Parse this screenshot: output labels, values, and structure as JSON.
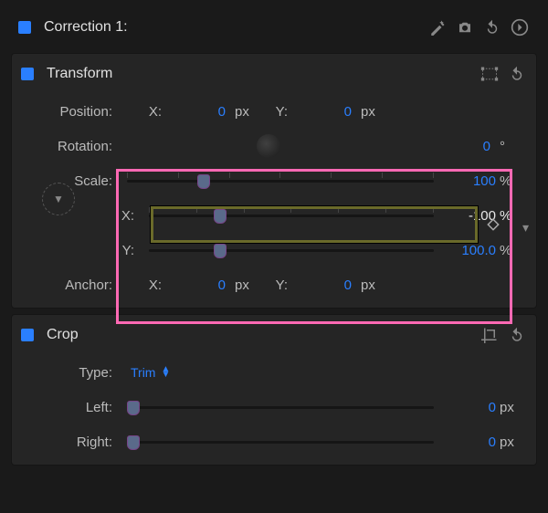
{
  "correction": {
    "title": "Correction 1:"
  },
  "transform": {
    "title": "Transform",
    "position": {
      "label": "Position:",
      "x_label": "X:",
      "x_value": "0",
      "x_unit": "px",
      "y_label": "Y:",
      "y_value": "0",
      "y_unit": "px"
    },
    "rotation": {
      "label": "Rotation:",
      "value": "0",
      "unit": "°"
    },
    "scale": {
      "label": "Scale:",
      "value": "100",
      "unit": "%"
    },
    "scale_x": {
      "label": "X:",
      "value": "-100",
      "unit": "%"
    },
    "scale_y": {
      "label": "Y:",
      "value": "100.0",
      "unit": "%"
    },
    "anchor": {
      "label": "Anchor:",
      "x_label": "X:",
      "x_value": "0",
      "x_unit": "px",
      "y_label": "Y:",
      "y_value": "0",
      "y_unit": "px"
    }
  },
  "crop": {
    "title": "Crop",
    "type": {
      "label": "Type:",
      "value": "Trim"
    },
    "left": {
      "label": "Left:",
      "value": "0",
      "unit": "px"
    },
    "right": {
      "label": "Right:",
      "value": "0",
      "unit": "px"
    }
  }
}
